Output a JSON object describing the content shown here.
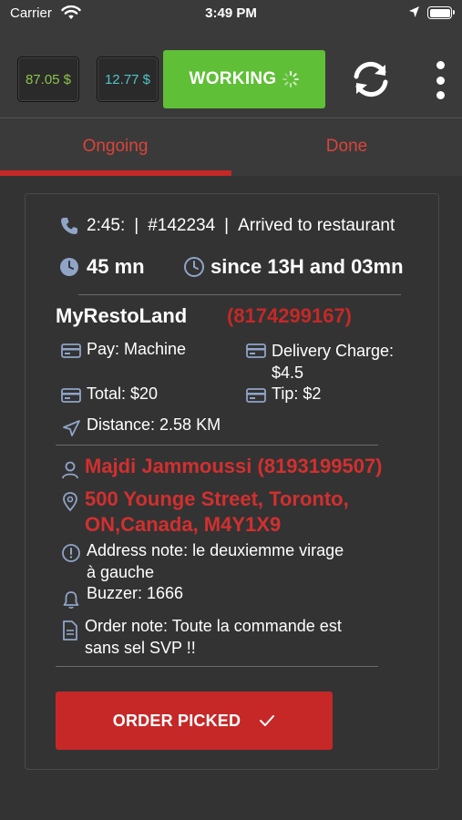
{
  "status_bar": {
    "carrier": "Carrier",
    "time": "3:49 PM"
  },
  "top_bar": {
    "balance_1": "87.05 $",
    "balance_2": "12.77 $",
    "working_label": "WORKING",
    "colors": {
      "working": "#5fbf36",
      "balance_1": "#8bc34a",
      "balance_2": "#4fc3c8"
    }
  },
  "tabs": [
    {
      "label": "Ongoing",
      "active": true
    },
    {
      "label": "Done",
      "active": false
    }
  ],
  "order": {
    "time": "2:45:",
    "number": "#142234",
    "status": "Arrived to restaurant",
    "duration": "45 mn",
    "since": "since 13H and 03mn",
    "restaurant_name": "MyRestoLand",
    "restaurant_phone": "(8174299167)",
    "pay": "Pay: Machine",
    "delivery_charge_label": "Delivery Charge:",
    "delivery_charge_value": "$4.5",
    "total": "Total: $20",
    "tip": "Tip: $2",
    "distance": "Distance: 2.58 KM",
    "customer": "Majdi Jammoussi (8193199507)",
    "address_line1": "500 Younge Street, Toronto,",
    "address_line2": "ON,Canada, M4Y1X9",
    "address_note_line1": "Address note: le deuxiemme virage",
    "address_note_line2": "à gauche",
    "buzzer": "Buzzer: 1666",
    "order_note_line1": "Order note: Toute la commande est",
    "order_note_line2": "sans sel SVP !!",
    "action_label": "ORDER PICKED",
    "accent_color": "#c62828"
  }
}
